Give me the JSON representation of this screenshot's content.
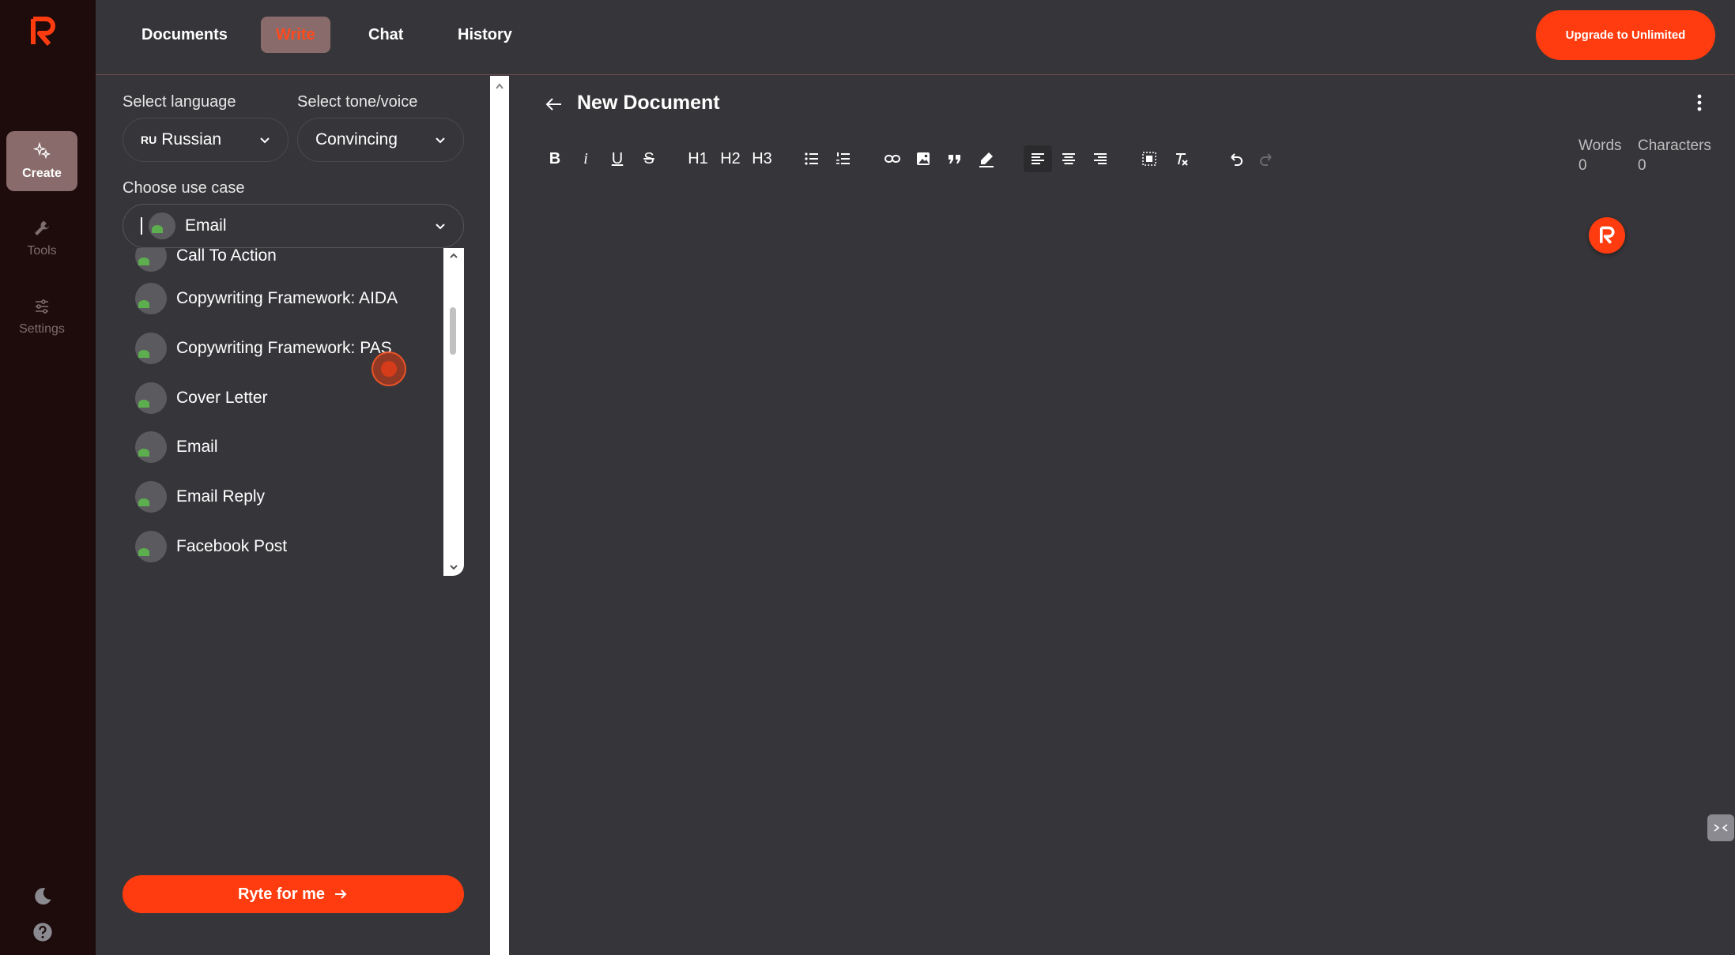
{
  "nav": {
    "tabs": [
      "Documents",
      "Write",
      "Chat",
      "History"
    ],
    "active_tab": "Write",
    "upgrade_label": "Upgrade to Unlimited"
  },
  "rail": {
    "items": [
      "Create",
      "Tools",
      "Settings"
    ],
    "active": "Create"
  },
  "panel": {
    "language_label": "Select language",
    "language_flag": "RU",
    "language_value": "Russian",
    "tone_label": "Select tone/voice",
    "tone_value": "Convincing",
    "usecase_label": "Choose use case",
    "usecase_value": "Email",
    "usecase_options": [
      "Call To Action",
      "Copywriting Framework: AIDA",
      "Copywriting Framework: PAS",
      "Cover Letter",
      "Email",
      "Email Reply",
      "Facebook Post"
    ],
    "ryte_label": "Ryte for me"
  },
  "editor": {
    "title": "New Document",
    "toolbar": [
      "B",
      "i",
      "U",
      "S",
      "H1",
      "H2",
      "H3"
    ],
    "words_label": "Words",
    "words_value": "0",
    "chars_label": "Characters",
    "chars_value": "0"
  },
  "colors": {
    "accent": "#ff3c0f",
    "rail_bg": "#1e0b0b",
    "active_tab_bg": "#8a6b6b",
    "surface": "#36363a"
  }
}
